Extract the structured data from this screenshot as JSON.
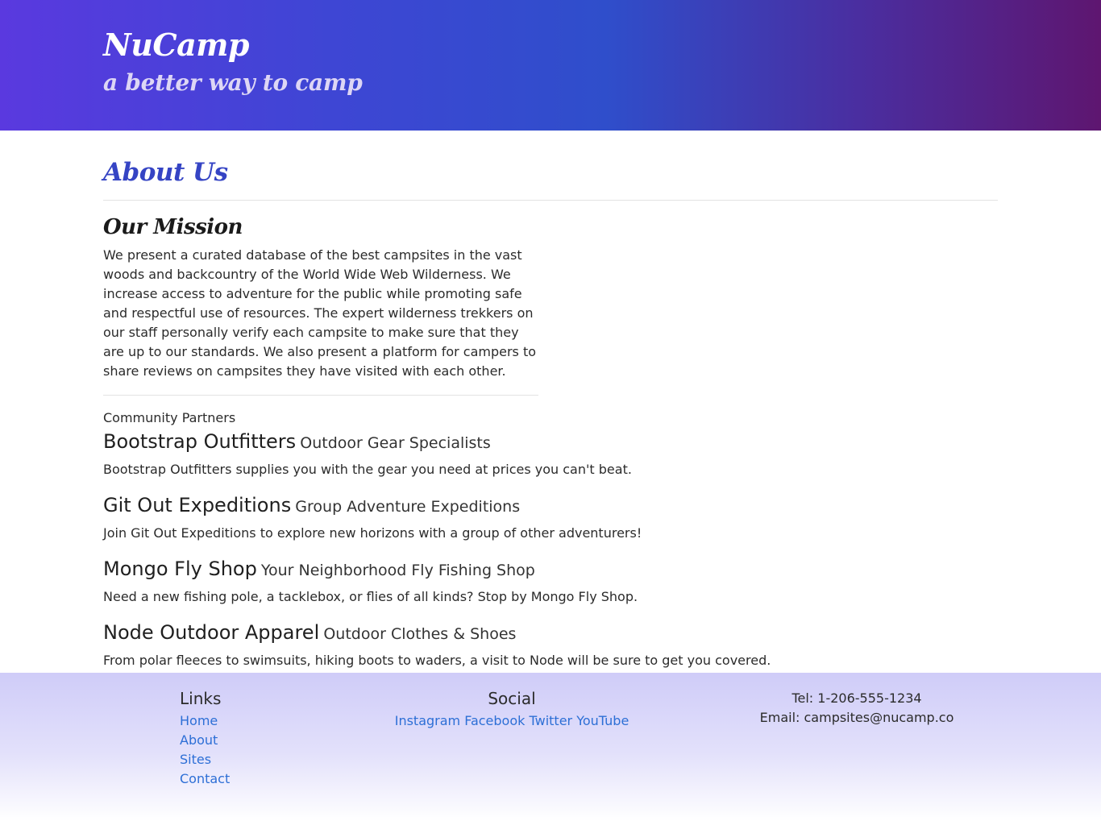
{
  "header": {
    "brand": "NuCamp",
    "tagline": "a better way to camp"
  },
  "main": {
    "page_title": "About Us",
    "mission": {
      "heading": "Our Mission",
      "text": "We present a curated database of the best campsites in the vast woods and backcountry of the World Wide Web Wilderness. We increase access to adventure for the public while promoting safe and respectful use of resources. The expert wilderness trekkers on our staff personally verify each campsite to make sure that they are up to our standards. We also present a platform for campers to share reviews on campsites they have visited with each other."
    },
    "partners_label": "Community Partners",
    "partners": [
      {
        "name": "Bootstrap Outfitters",
        "subtitle": "Outdoor Gear Specialists",
        "description": "Bootstrap Outfitters supplies you with the gear you need at prices you can't beat."
      },
      {
        "name": "Git Out Expeditions",
        "subtitle": "Group Adventure Expeditions",
        "description": "Join Git Out Expeditions to explore new horizons with a group of other adventurers!"
      },
      {
        "name": "Mongo Fly Shop",
        "subtitle": "Your Neighborhood Fly Fishing Shop",
        "description": "Need a new fishing pole, a tacklebox, or flies of all kinds? Stop by Mongo Fly Shop."
      },
      {
        "name": "Node Outdoor Apparel",
        "subtitle": "Outdoor Clothes & Shoes",
        "description": "From polar fleeces to swimsuits, hiking boots to waders, a visit to Node will be sure to get you covered."
      }
    ]
  },
  "footer": {
    "links_heading": "Links",
    "links": [
      "Home",
      "About",
      "Sites",
      "Contact"
    ],
    "social_heading": "Social",
    "social": [
      "Instagram",
      "Facebook",
      "Twitter",
      "YouTube"
    ],
    "contact": {
      "tel": "Tel: 1-206-555-1234",
      "email_label": "Email: ",
      "email": "campsites@nucamp.co"
    }
  },
  "colors": {
    "header_gradient_start": "#5a39df",
    "header_gradient_end": "#5e1670",
    "heading_accent": "#3544c4",
    "link": "#2d6fd6",
    "footer_bg": "#cfccf8"
  }
}
